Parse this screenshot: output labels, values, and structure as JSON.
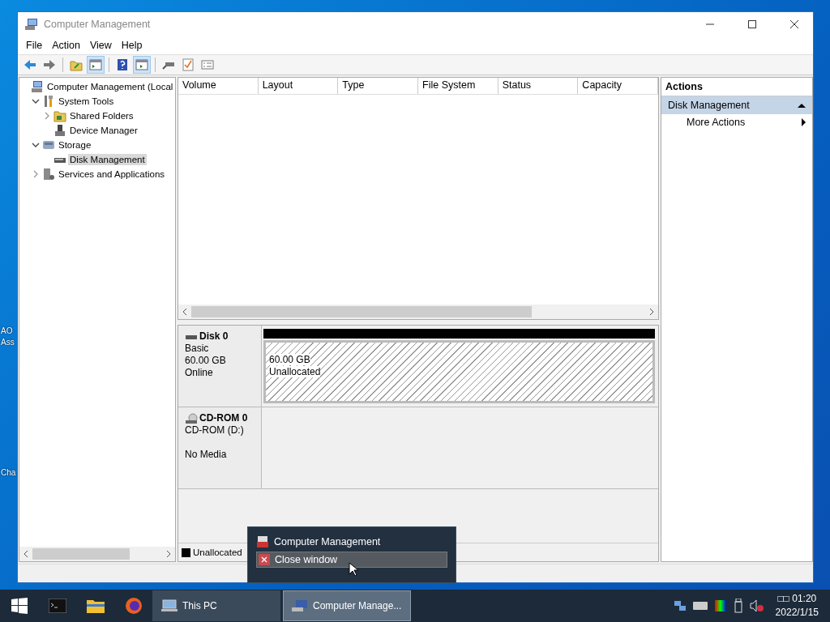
{
  "desktop": {
    "icon_labels": [
      "AO",
      "Ass",
      "Cha"
    ]
  },
  "window": {
    "title": "Computer Management"
  },
  "menu": [
    "File",
    "Action",
    "View",
    "Help"
  ],
  "toolbar": [
    {
      "kind": "back",
      "pressed": false
    },
    {
      "kind": "forward",
      "pressed": false
    },
    {
      "kind": "up",
      "pressed": false
    },
    {
      "kind": "console-tree",
      "pressed": true
    },
    {
      "kind": "help",
      "pressed": false
    },
    {
      "kind": "action-pane",
      "pressed": true
    },
    {
      "kind": "connect",
      "pressed": false
    },
    {
      "kind": "check",
      "pressed": false
    },
    {
      "kind": "properties",
      "pressed": false
    }
  ],
  "tree": [
    {
      "label": "Computer Management (Local",
      "kind": "computer",
      "selected": false,
      "children": [
        {
          "label": "System Tools",
          "kind": "tools",
          "expanded": true,
          "selected": false,
          "children": [
            {
              "label": "Shared Folders",
              "kind": "folder",
              "expanded": false,
              "selected": false
            },
            {
              "label": "Device Manager",
              "kind": "device",
              "selected": false
            }
          ]
        },
        {
          "label": "Storage",
          "kind": "storage",
          "expanded": true,
          "selected": false,
          "children": [
            {
              "label": "Disk Management",
              "kind": "disk",
              "selected": true
            }
          ]
        },
        {
          "label": "Services and Applications",
          "kind": "services",
          "expanded": false,
          "selected": false
        }
      ]
    }
  ],
  "volume_list": {
    "columns": [
      "Volume",
      "Layout",
      "Type",
      "File System",
      "Status",
      "Capacity"
    ]
  },
  "disks": [
    {
      "name": "Disk 0",
      "kind": "disk",
      "type": "Basic",
      "size": "60.00 GB",
      "status": "Online",
      "partition": {
        "size": "60.00 GB",
        "status": "Unallocated"
      }
    },
    {
      "name": "CD-ROM 0",
      "kind": "cdrom",
      "type": "CD-ROM (D:)",
      "status": "No Media"
    }
  ],
  "legend": [
    {
      "label": "Unallocated",
      "color": "#000000"
    }
  ],
  "actions": {
    "title": "Actions",
    "sections": [
      {
        "label": "Disk Management",
        "expanded": true,
        "items": [
          "More Actions"
        ]
      }
    ]
  },
  "popup": {
    "title": "Computer Management",
    "items": [
      {
        "label": "Close window",
        "selected": true
      }
    ]
  },
  "taskbar": {
    "windows": [
      {
        "label": "This PC",
        "kind": "pc",
        "active": false
      },
      {
        "label": "Computer Manage...",
        "kind": "computer",
        "active": true
      }
    ],
    "clock": {
      "time": "□□ 01:20",
      "date": "2022/1/15"
    }
  }
}
